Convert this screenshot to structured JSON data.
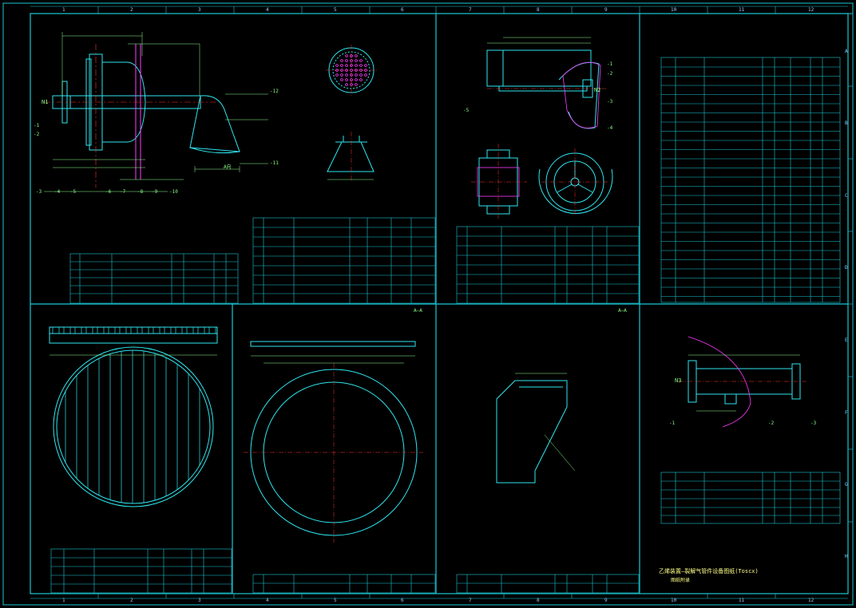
{
  "colors": {
    "background": "#000000",
    "frame": "#19c8d6",
    "outline": "#2ee6f0",
    "text": "#8fff8f",
    "centerline": "#ff3030",
    "hatch": "#ff3cff",
    "yellow": "#ffff6e"
  },
  "border": {
    "top_numbers": [
      "1",
      "2",
      "3",
      "4",
      "5",
      "6",
      "7",
      "8",
      "9",
      "10",
      "11",
      "12"
    ],
    "side_letters": [
      "A",
      "B",
      "C",
      "D",
      "E",
      "F",
      "G",
      "H"
    ]
  },
  "views": {
    "top_left": {
      "nozzle_mark": "N1",
      "section_mark": "A向",
      "part_numbers": [
        "-3",
        "-4",
        "-5",
        "-6",
        "-7",
        "-8",
        "-9",
        "-10",
        "-11",
        "-12",
        "-1",
        "-2"
      ]
    },
    "top_mid_right": {
      "nozzle_mark": "N2",
      "part_numbers": [
        "-1",
        "-2",
        "-3",
        "-4",
        "-5"
      ]
    },
    "bottom_right": {
      "nozzle_mark": "N3",
      "part_numbers": [
        "-1",
        "-2",
        "-3"
      ]
    },
    "bottom_mid": {
      "section_mark": "A—A"
    }
  },
  "footer": {
    "title_line1": "乙烯装置—裂解气管件设备图纸(Toscx)",
    "title_line2": "图纸附录"
  }
}
